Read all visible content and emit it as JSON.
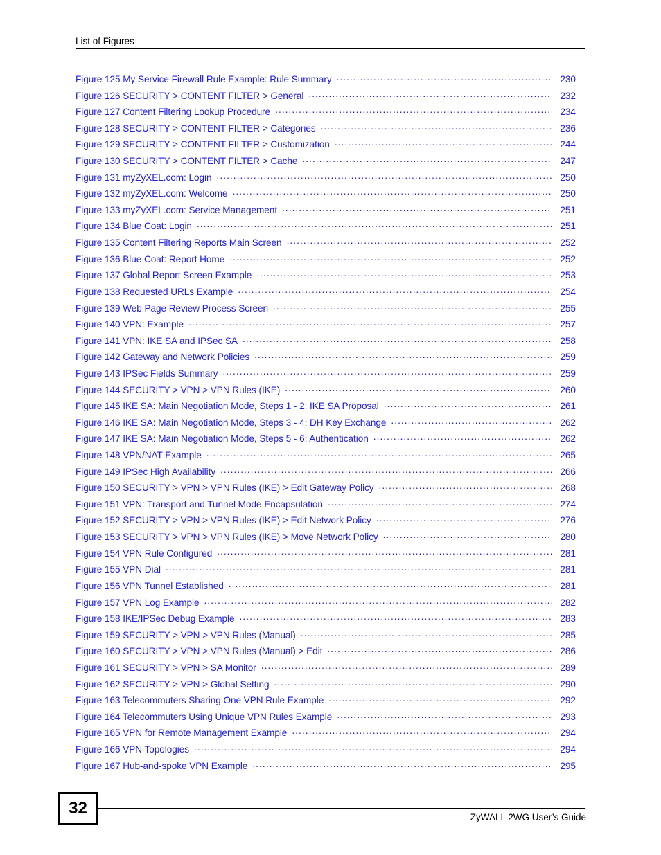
{
  "header": {
    "title": "List of Figures"
  },
  "footer": {
    "page_number": "32",
    "guide_title": "ZyWALL 2WG User’s Guide"
  },
  "colors": {
    "entry_text": "#2020e0",
    "header_text": "#000000",
    "rule": "#000000"
  },
  "list_of_figures": [
    {
      "label": "Figure 125 My Service Firewall Rule Example: Rule Summary",
      "page": "230"
    },
    {
      "label": "Figure 126 SECURITY > CONTENT FILTER > General",
      "page": "232"
    },
    {
      "label": "Figure 127 Content Filtering Lookup Procedure",
      "page": "234"
    },
    {
      "label": "Figure 128 SECURITY > CONTENT FILTER > Categories",
      "page": "236"
    },
    {
      "label": "Figure 129 SECURITY > CONTENT FILTER > Customization",
      "page": "244"
    },
    {
      "label": "Figure 130 SECURITY > CONTENT FILTER > Cache",
      "page": "247"
    },
    {
      "label": "Figure 131 myZyXEL.com: Login",
      "page": "250"
    },
    {
      "label": "Figure 132 myZyXEL.com: Welcome",
      "page": "250"
    },
    {
      "label": "Figure 133 myZyXEL.com: Service Management",
      "page": "251"
    },
    {
      "label": "Figure 134 Blue Coat: Login",
      "page": "251"
    },
    {
      "label": "Figure 135 Content Filtering Reports Main Screen",
      "page": "252"
    },
    {
      "label": "Figure 136 Blue Coat: Report Home",
      "page": "252"
    },
    {
      "label": "Figure 137 Global Report Screen Example",
      "page": "253"
    },
    {
      "label": "Figure 138 Requested URLs Example",
      "page": "254"
    },
    {
      "label": "Figure 139 Web Page Review Process Screen",
      "page": "255"
    },
    {
      "label": "Figure 140 VPN: Example",
      "page": "257"
    },
    {
      "label": "Figure 141 VPN: IKE SA and IPSec SA",
      "page": "258"
    },
    {
      "label": "Figure 142 Gateway and Network Policies",
      "page": "259"
    },
    {
      "label": "Figure 143 IPSec Fields Summary",
      "page": "259"
    },
    {
      "label": "Figure 144 SECURITY > VPN > VPN Rules (IKE)",
      "page": "260"
    },
    {
      "label": "Figure 145 IKE SA: Main Negotiation Mode, Steps 1 - 2: IKE SA Proposal",
      "page": "261"
    },
    {
      "label": "Figure 146 IKE SA: Main Negotiation Mode, Steps 3 - 4: DH Key Exchange",
      "page": "262"
    },
    {
      "label": "Figure 147 IKE SA: Main Negotiation Mode, Steps 5 - 6: Authentication",
      "page": "262"
    },
    {
      "label": "Figure 148 VPN/NAT Example",
      "page": "265"
    },
    {
      "label": "Figure 149 IPSec High Availability",
      "page": "266"
    },
    {
      "label": "Figure 150 SECURITY > VPN > VPN Rules (IKE) > Edit Gateway Policy",
      "page": "268"
    },
    {
      "label": "Figure 151 VPN: Transport and Tunnel Mode Encapsulation",
      "page": "274"
    },
    {
      "label": "Figure 152 SECURITY > VPN > VPN Rules (IKE) > Edit Network Policy",
      "page": "276"
    },
    {
      "label": "Figure 153 SECURITY > VPN > VPN Rules (IKE) > Move Network Policy",
      "page": "280"
    },
    {
      "label": "Figure 154 VPN Rule Configured",
      "page": "281"
    },
    {
      "label": "Figure 155 VPN Dial",
      "page": "281"
    },
    {
      "label": "Figure 156 VPN Tunnel Established",
      "page": "281"
    },
    {
      "label": "Figure 157 VPN Log Example",
      "page": "282"
    },
    {
      "label": "Figure 158 IKE/IPSec Debug Example",
      "page": "283"
    },
    {
      "label": "Figure 159 SECURITY > VPN > VPN Rules (Manual)",
      "page": "285"
    },
    {
      "label": "Figure 160 SECURITY > VPN > VPN Rules (Manual) > Edit",
      "page": "286"
    },
    {
      "label": "Figure 161 SECURITY > VPN > SA Monitor",
      "page": "289"
    },
    {
      "label": "Figure 162 SECURITY > VPN > Global Setting",
      "page": "290"
    },
    {
      "label": "Figure 163 Telecommuters Sharing One VPN Rule Example",
      "page": "292"
    },
    {
      "label": "Figure 164 Telecommuters Using Unique VPN Rules Example",
      "page": "293"
    },
    {
      "label": "Figure 165 VPN for Remote Management Example",
      "page": "294"
    },
    {
      "label": "Figure 166 VPN Topologies",
      "page": "294"
    },
    {
      "label": "Figure 167 Hub-and-spoke VPN Example",
      "page": "295"
    }
  ]
}
